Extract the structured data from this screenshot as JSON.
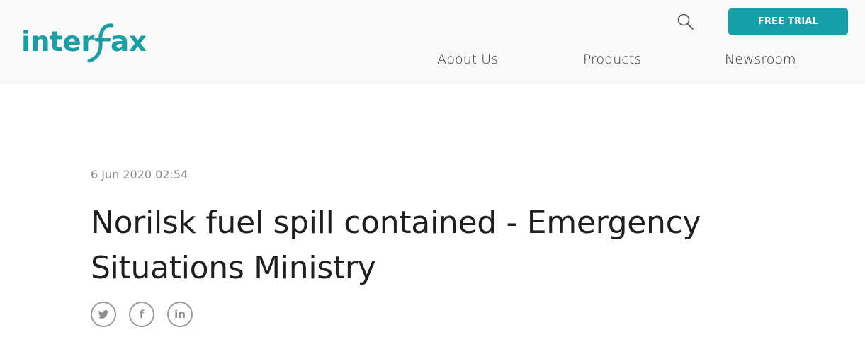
{
  "header": {
    "logo_text": "interfax",
    "brand_color": "#179fa7",
    "search_icon": "search-icon",
    "cta_label": "FREE TRIAL"
  },
  "nav": {
    "items": [
      {
        "label": "About Us"
      },
      {
        "label": "Products"
      },
      {
        "label": "Newsroom"
      }
    ]
  },
  "article": {
    "date": "6 Jun 2020 02:54",
    "title": "Norilsk fuel spill contained - Emergency Situations Ministry"
  },
  "share": {
    "icons": [
      "twitter-icon",
      "facebook-icon",
      "linkedin-icon"
    ],
    "facebook_glyph": "f",
    "linkedin_glyph": "in"
  }
}
